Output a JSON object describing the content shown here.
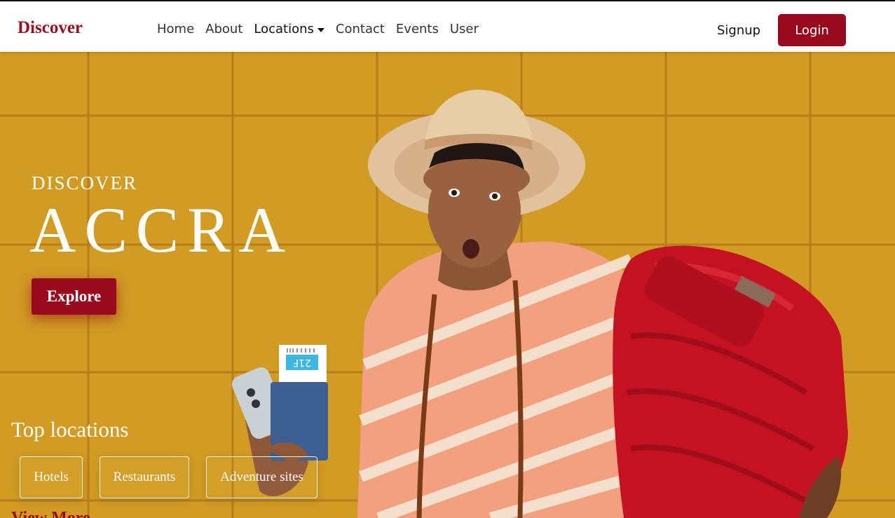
{
  "navbar": {
    "brand": "Discover",
    "links": [
      {
        "label": "Home"
      },
      {
        "label": "About"
      },
      {
        "label": "Locations"
      },
      {
        "label": "Contact"
      },
      {
        "label": "Events"
      },
      {
        "label": "User"
      }
    ],
    "signup_label": "Signup",
    "login_label": "Login"
  },
  "hero": {
    "kicker": "DISCOVER",
    "headline": "ACCRA",
    "explore_label": "Explore",
    "top_locations_title": "Top locations",
    "chips": [
      {
        "label": "Hotels"
      },
      {
        "label": "Restaurants"
      },
      {
        "label": "Adventure sites"
      }
    ],
    "view_more_label": "View More",
    "boarding_pass_seat": "21F"
  },
  "colors": {
    "brand": "#9a0a1e",
    "hero_background": "#d29b24",
    "text_light": "#ffffff"
  }
}
